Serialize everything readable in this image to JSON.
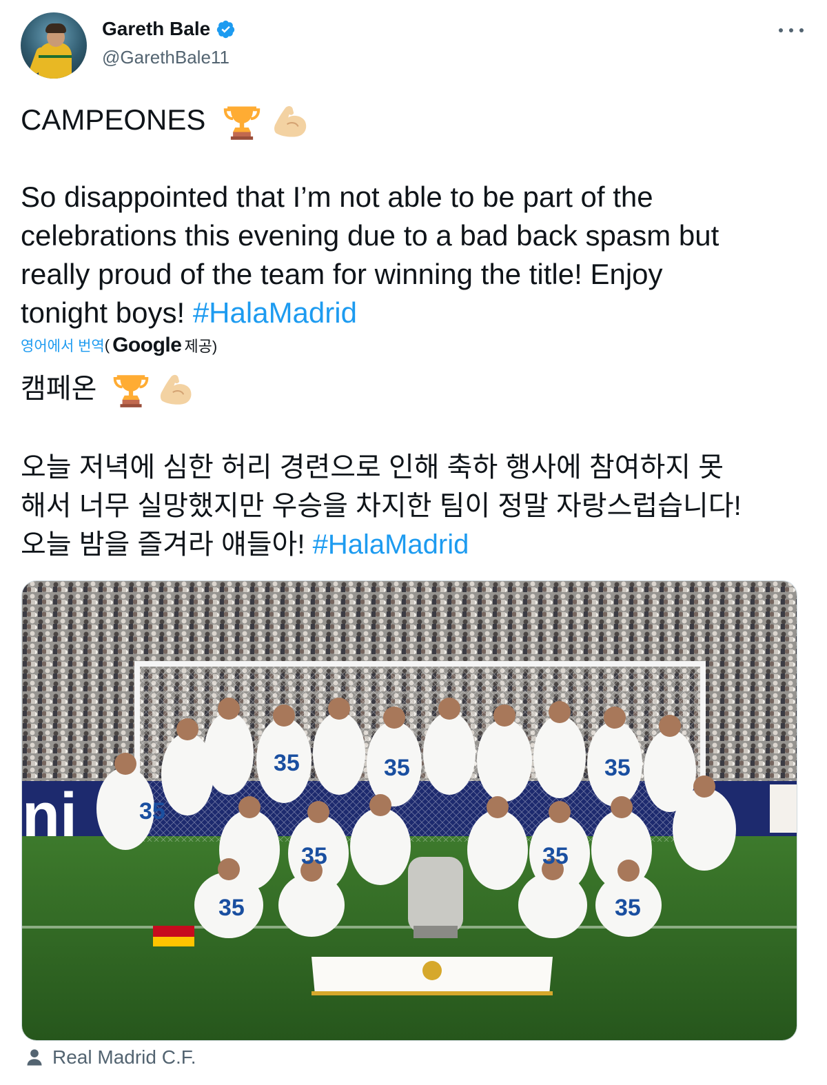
{
  "author": {
    "display_name": "Gareth Bale",
    "handle": "@GarethBale11",
    "verified": true,
    "avatar_icon": "avatar-photo"
  },
  "tweet": {
    "lines": [
      "CAMPEONES",
      "So disappointed that I’m not able to be part of the",
      "celebrations this evening due to a bad back spasm but",
      "really proud of the team for winning the title! Enjoy",
      "tonight boys! "
    ],
    "hashtag": "#HalaMadrid",
    "emojis": [
      "trophy-icon",
      "flexed-biceps-icon"
    ]
  },
  "translation": {
    "link_label": "영어에서 번역",
    "open_paren": "(",
    "provider": "Google",
    "provider_suffix": "제공)",
    "lines": [
      "캠페온",
      " 오늘 저녁에 심한 허리 경련으로 인해 축하 행사에 참여하지 못",
      "해서 너무 실망했지만 우승을 차지한 팀이 정말 자랑스럽습니다!",
      "오늘 밤을 즐겨라 얘들아! "
    ],
    "hashtag": "#HalaMadrid"
  },
  "media": {
    "credit": "Real Madrid C.F."
  },
  "colors": {
    "link": "#1d9bf0",
    "secondary_text": "#536471",
    "primary_text": "#0f1419"
  }
}
